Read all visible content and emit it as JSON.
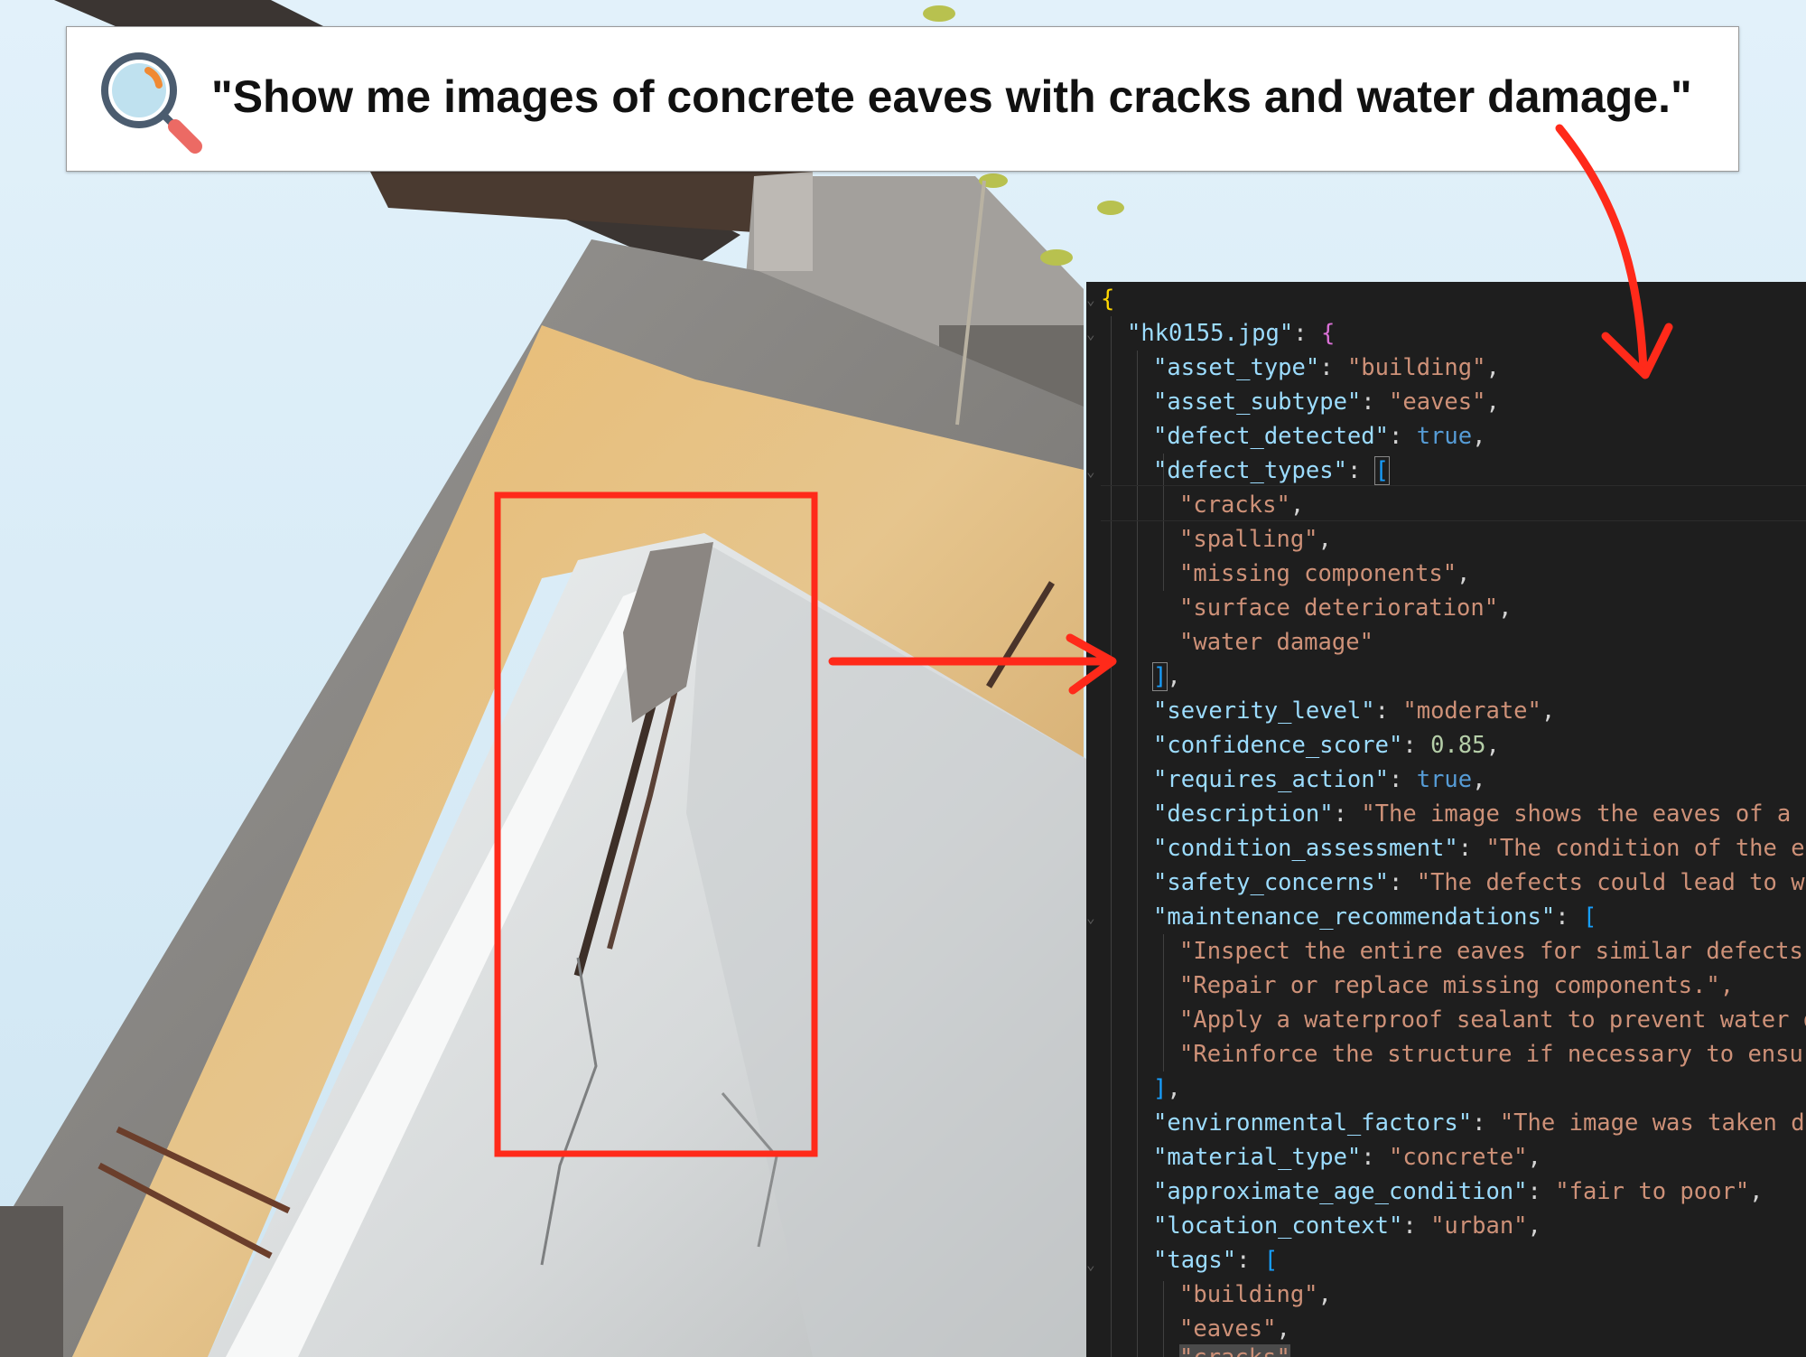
{
  "search": {
    "query": "\"Show me images of concrete eaves with cracks and water damage.\"",
    "icon": "magnifier-icon"
  },
  "colors": {
    "annotation_red": "#ff2a1a",
    "code_background": "#1e1e1e",
    "json_key": "#9cdcfe",
    "json_string": "#ce9178",
    "json_boolean": "#569cd6",
    "json_number": "#b5cea8"
  },
  "code": {
    "open_brace": "{",
    "file_key": "\"hk0155.jpg\"",
    "file_open": "{",
    "asset_type_key": "\"asset_type\"",
    "asset_type_value": "\"building\"",
    "asset_subtype_key": "\"asset_subtype\"",
    "asset_subtype_value": "\"eaves\"",
    "defect_detected_key": "\"defect_detected\"",
    "defect_detected_value": "true",
    "defect_types_key": "\"defect_types\"",
    "defect_types_open": "[",
    "defect_types": [
      "\"cracks\"",
      "\"spalling\"",
      "\"missing components\"",
      "\"surface deterioration\"",
      "\"water damage\""
    ],
    "defect_types_close": "]",
    "severity_level_key": "\"severity_level\"",
    "severity_level_value": "\"moderate\"",
    "confidence_score_key": "\"confidence_score\"",
    "confidence_score_value": "0.85",
    "requires_action_key": "\"requires_action\"",
    "requires_action_value": "true",
    "description_key": "\"description\"",
    "description_value": "\"The image shows the eaves of a b",
    "condition_assessment_key": "\"condition_assessment\"",
    "condition_assessment_value": "\"The condition of the ea",
    "safety_concerns_key": "\"safety_concerns\"",
    "safety_concerns_value": "\"The defects could lead to wa",
    "maintenance_recommendations_key": "\"maintenance_recommendations\"",
    "maintenance_open": "[",
    "maintenance_recommendations": [
      "\"Inspect the entire eaves for similar defects.",
      "\"Repair or replace missing components.\",",
      "\"Apply a waterproof sealant to prevent water d",
      "\"Reinforce the structure if necessary to ensur"
    ],
    "maintenance_close": "]",
    "environmental_factors_key": "\"environmental_factors\"",
    "environmental_factors_value": "\"The image was taken du",
    "material_type_key": "\"material_type\"",
    "material_type_value": "\"concrete\"",
    "approximate_age_condition_key": "\"approximate_age_condition\"",
    "approximate_age_condition_value": "\"fair to poor\"",
    "location_context_key": "\"location_context\"",
    "location_context_value": "\"urban\"",
    "tags_key": "\"tags\"",
    "tags_open": "[",
    "tags": [
      "\"building\"",
      "\"eaves\"",
      "\"cracks\""
    ]
  }
}
